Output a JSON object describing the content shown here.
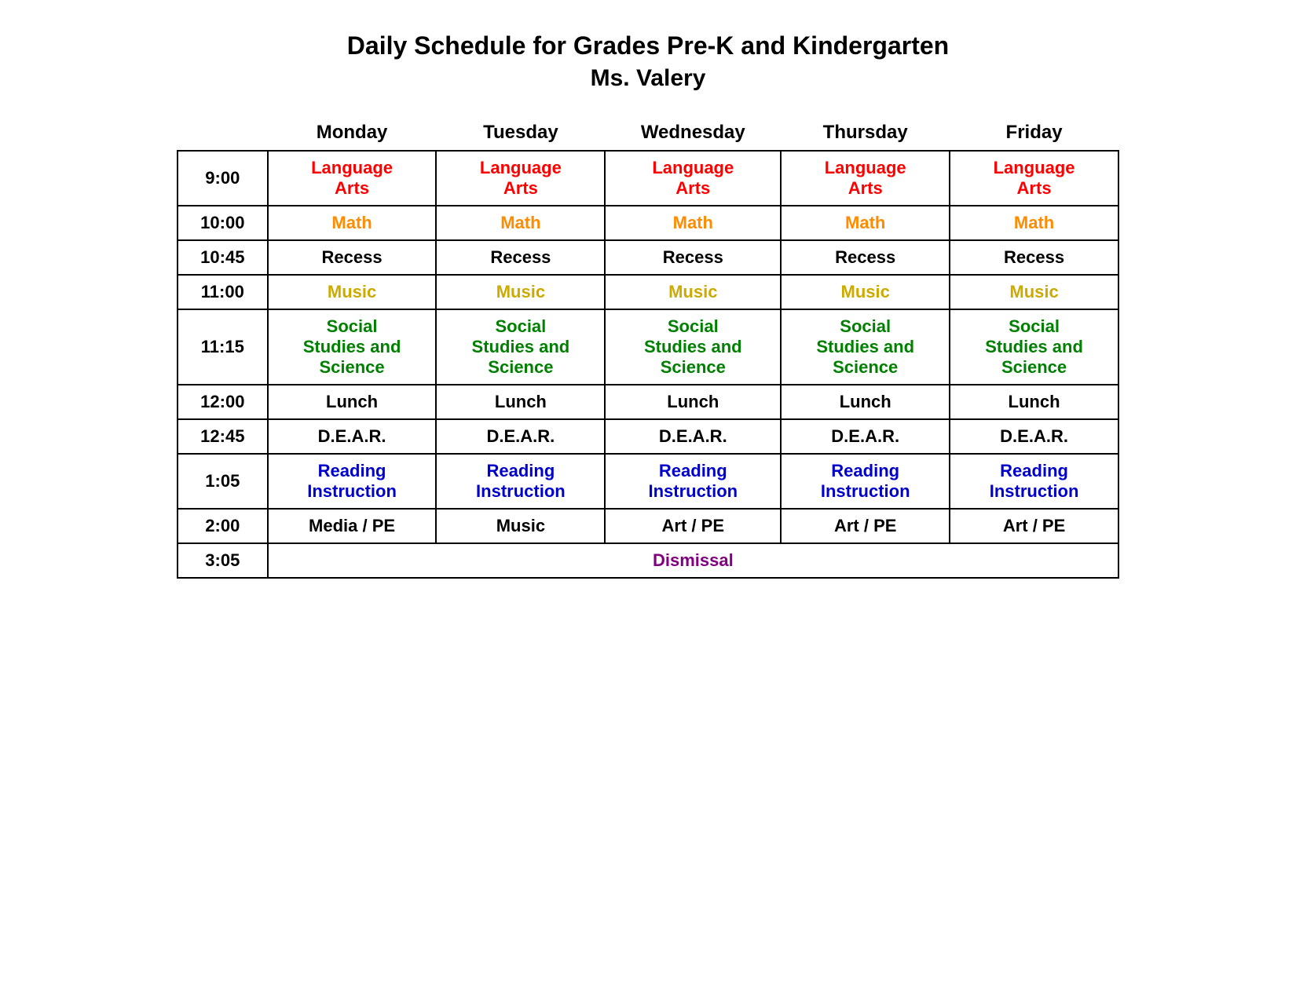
{
  "title": "Daily Schedule for Grades Pre-K and Kindergarten",
  "subtitle": "Ms. Valery",
  "columns": [
    "",
    "Monday",
    "Tuesday",
    "Wednesday",
    "Thursday",
    "Friday"
  ],
  "rows": [
    {
      "time": "9:00",
      "cells": [
        {
          "text": "Language Arts",
          "color": "red"
        },
        {
          "text": "Language Arts",
          "color": "red"
        },
        {
          "text": "Language Arts",
          "color": "red"
        },
        {
          "text": "Language Arts",
          "color": "red"
        },
        {
          "text": "Language Arts",
          "color": "red"
        }
      ]
    },
    {
      "time": "10:00",
      "cells": [
        {
          "text": "Math",
          "color": "orange"
        },
        {
          "text": "Math",
          "color": "orange"
        },
        {
          "text": "Math",
          "color": "orange"
        },
        {
          "text": "Math",
          "color": "orange"
        },
        {
          "text": "Math",
          "color": "orange"
        }
      ]
    },
    {
      "time": "10:45",
      "cells": [
        {
          "text": "Recess",
          "color": "black"
        },
        {
          "text": "Recess",
          "color": "black"
        },
        {
          "text": "Recess",
          "color": "black"
        },
        {
          "text": "Recess",
          "color": "black"
        },
        {
          "text": "Recess",
          "color": "black"
        }
      ]
    },
    {
      "time": "11:00",
      "cells": [
        {
          "text": "Music",
          "color": "yellow-dark"
        },
        {
          "text": "Music",
          "color": "yellow-dark"
        },
        {
          "text": "Music",
          "color": "yellow-dark"
        },
        {
          "text": "Music",
          "color": "yellow-dark"
        },
        {
          "text": "Music",
          "color": "yellow-dark"
        }
      ]
    },
    {
      "time": "11:15",
      "cells": [
        {
          "text": "Social Studies and Science",
          "color": "green"
        },
        {
          "text": "Social Studies and Science",
          "color": "green"
        },
        {
          "text": "Social Studies and Science",
          "color": "green"
        },
        {
          "text": "Social Studies and Science",
          "color": "green"
        },
        {
          "text": "Social Studies and Science",
          "color": "green"
        }
      ]
    },
    {
      "time": "12:00",
      "cells": [
        {
          "text": "Lunch",
          "color": "black"
        },
        {
          "text": "Lunch",
          "color": "black"
        },
        {
          "text": "Lunch",
          "color": "black"
        },
        {
          "text": "Lunch",
          "color": "black"
        },
        {
          "text": "Lunch",
          "color": "black"
        }
      ]
    },
    {
      "time": "12:45",
      "cells": [
        {
          "text": "D.E.A.R.",
          "color": "black"
        },
        {
          "text": "D.E.A.R.",
          "color": "black"
        },
        {
          "text": "D.E.A.R.",
          "color": "black"
        },
        {
          "text": "D.E.A.R.",
          "color": "black"
        },
        {
          "text": "D.E.A.R.",
          "color": "black"
        }
      ]
    },
    {
      "time": "1:05",
      "cells": [
        {
          "text": "Reading Instruction",
          "color": "blue"
        },
        {
          "text": "Reading Instruction",
          "color": "blue"
        },
        {
          "text": "Reading Instruction",
          "color": "blue"
        },
        {
          "text": "Reading Instruction",
          "color": "blue"
        },
        {
          "text": "Reading Instruction",
          "color": "blue"
        }
      ]
    },
    {
      "time": "2:00",
      "cells": [
        {
          "text": "Media / PE",
          "color": "black"
        },
        {
          "text": "Music",
          "color": "black"
        },
        {
          "text": "Art / PE",
          "color": "black"
        },
        {
          "text": "Art / PE",
          "color": "black"
        },
        {
          "text": "Art / PE",
          "color": "black"
        }
      ]
    },
    {
      "time": "3:05",
      "dismissal": true,
      "dismissal_text": "Dismissal"
    }
  ]
}
